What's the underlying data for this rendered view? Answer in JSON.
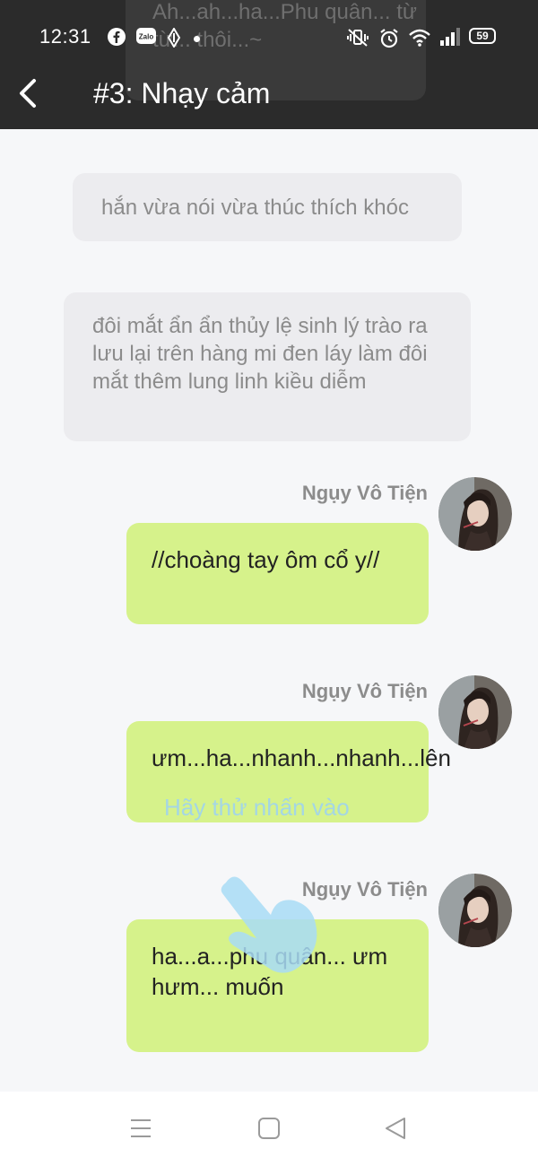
{
  "notification": {
    "ghost_text": "Ah...ah...ha...Phu quân... từ từ... thôi...~"
  },
  "status_bar": {
    "time": "12:31",
    "battery": "59",
    "icons": [
      "facebook-icon",
      "zalo-icon",
      "app-icon",
      "mute-icon",
      "alarm-icon",
      "wifi-icon",
      "signal-icon",
      "battery-icon"
    ]
  },
  "header": {
    "title": "#3: Nhạy cảm",
    "back_icon": "chevron-left-icon"
  },
  "messages": {
    "narration_1": "hắn vừa nói vừa thúc thích khóc",
    "narration_2": "đôi mắt ẩn ẩn thủy lệ sinh lý trào ra lưu lại trên hàng mi đen láy làm đôi mắt thêm lung linh kiều diễm",
    "m1": {
      "sender": "Ngụy Vô Tiện",
      "text": "//choàng tay ôm cổ y//"
    },
    "m2": {
      "sender": "Ngụy Vô Tiện",
      "text": "ưm...ha...nhanh...nhanh...lên"
    },
    "m3": {
      "sender": "Ngụy Vô Tiện",
      "text": "ha...a...phu quân... ưm hưm... muốn"
    }
  },
  "overlay": {
    "hint": "Hãy thử nhấn vào",
    "icon": "tap-hand-icon"
  },
  "nav": {
    "icons": [
      "menu-icon",
      "home-icon",
      "back-triangle-icon"
    ]
  },
  "colors": {
    "topbar": "#2b2b2b",
    "my_bubble": "#d6f28b",
    "narration_bubble": "#ececef",
    "hint": "#9fd3ee"
  }
}
